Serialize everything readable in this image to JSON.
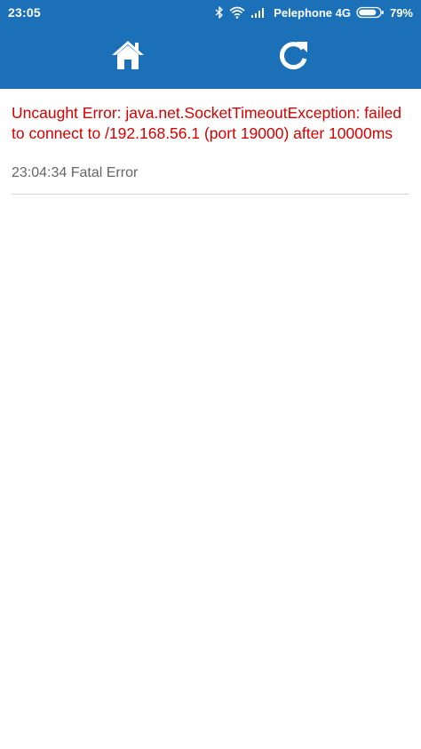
{
  "status_bar": {
    "time": "23:05",
    "carrier": "Pelephone 4G",
    "battery": "79%",
    "icons": [
      "bluetooth-icon",
      "wifi-icon",
      "signal-icon",
      "battery-icon"
    ]
  },
  "toolbar": {
    "home_icon": "home-icon",
    "reload_icon": "reload-icon"
  },
  "error": {
    "message": "Uncaught Error: java.net.SocketTimeoutException: failed to connect to /192.168.56.1 (port 19000) after 10000ms",
    "log": "23:04:34 Fatal Error"
  },
  "colors": {
    "header": "#1b70b8",
    "error_text": "#d50000",
    "log_text": "#666666"
  }
}
